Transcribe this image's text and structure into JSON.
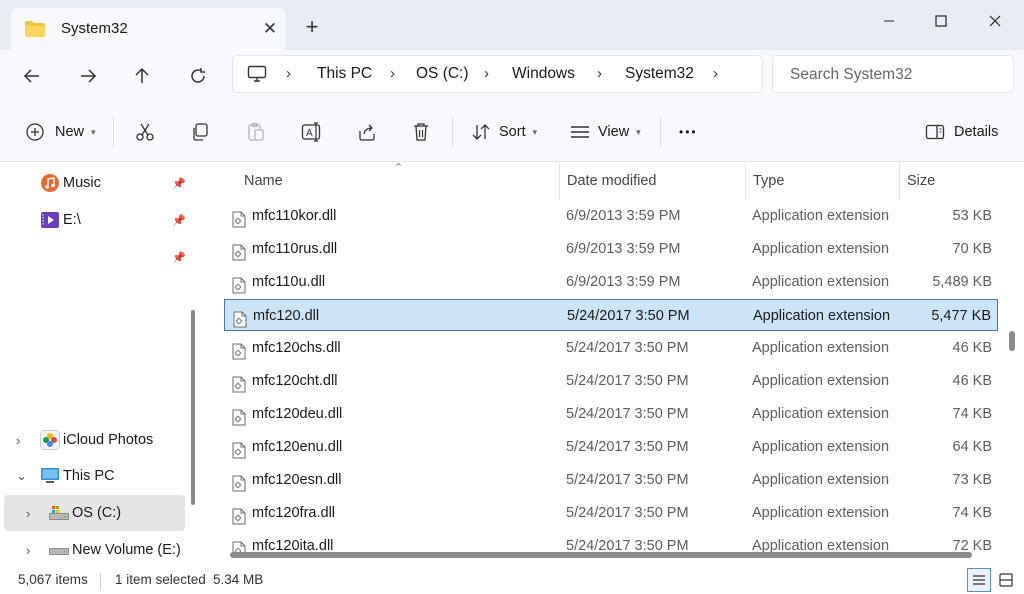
{
  "window": {
    "tab_title": "System32",
    "tab_close": "✕",
    "new_tab": "+",
    "controls": {
      "minimize": "—",
      "maximize": "☐",
      "close": "✕"
    }
  },
  "nav": {
    "breadcrumb": [
      "This PC",
      "OS (C:)",
      "Windows",
      "System32"
    ],
    "search_placeholder": "Search System32"
  },
  "toolbar": {
    "new_label": "New",
    "sort_label": "Sort",
    "view_label": "View",
    "more_label": "•••",
    "details_label": "Details"
  },
  "sidebar": {
    "items": [
      {
        "label": "Music",
        "icon": "music-icon",
        "pinned": true
      },
      {
        "label": "E:\\",
        "icon": "video-drive-icon",
        "pinned": true
      },
      {
        "label": "",
        "icon": "",
        "pinned": true
      },
      {
        "label": "iCloud Photos",
        "icon": "icloud-photos-icon"
      },
      {
        "label": "This PC",
        "icon": "this-pc-icon"
      },
      {
        "label": "OS (C:)",
        "icon": "drive-c-icon",
        "selected": true
      },
      {
        "label": "New Volume (E:)",
        "icon": "drive-icon"
      }
    ]
  },
  "columns": {
    "name": "Name",
    "date": "Date modified",
    "type": "Type",
    "size": "Size"
  },
  "files": [
    {
      "name": "mfc110kor.dll",
      "date": "6/9/2013 3:59 PM",
      "type": "Application extension",
      "size": "53 KB"
    },
    {
      "name": "mfc110rus.dll",
      "date": "6/9/2013 3:59 PM",
      "type": "Application extension",
      "size": "70 KB"
    },
    {
      "name": "mfc110u.dll",
      "date": "6/9/2013 3:59 PM",
      "type": "Application extension",
      "size": "5,489 KB"
    },
    {
      "name": "mfc120.dll",
      "date": "5/24/2017 3:50 PM",
      "type": "Application extension",
      "size": "5,477 KB",
      "selected": true
    },
    {
      "name": "mfc120chs.dll",
      "date": "5/24/2017 3:50 PM",
      "type": "Application extension",
      "size": "46 KB"
    },
    {
      "name": "mfc120cht.dll",
      "date": "5/24/2017 3:50 PM",
      "type": "Application extension",
      "size": "46 KB"
    },
    {
      "name": "mfc120deu.dll",
      "date": "5/24/2017 3:50 PM",
      "type": "Application extension",
      "size": "74 KB"
    },
    {
      "name": "mfc120enu.dll",
      "date": "5/24/2017 3:50 PM",
      "type": "Application extension",
      "size": "64 KB"
    },
    {
      "name": "mfc120esn.dll",
      "date": "5/24/2017 3:50 PM",
      "type": "Application extension",
      "size": "73 KB"
    },
    {
      "name": "mfc120fra.dll",
      "date": "5/24/2017 3:50 PM",
      "type": "Application extension",
      "size": "74 KB"
    },
    {
      "name": "mfc120ita.dll",
      "date": "5/24/2017 3:50 PM",
      "type": "Application extension",
      "size": "72 KB"
    }
  ],
  "status": {
    "item_count": "5,067 items",
    "selection": "1 item selected",
    "selection_size": "5.34 MB"
  },
  "colors": {
    "accent": "#0078d4",
    "selection": "#cce4f7",
    "selection_border": "#4a78a8"
  }
}
